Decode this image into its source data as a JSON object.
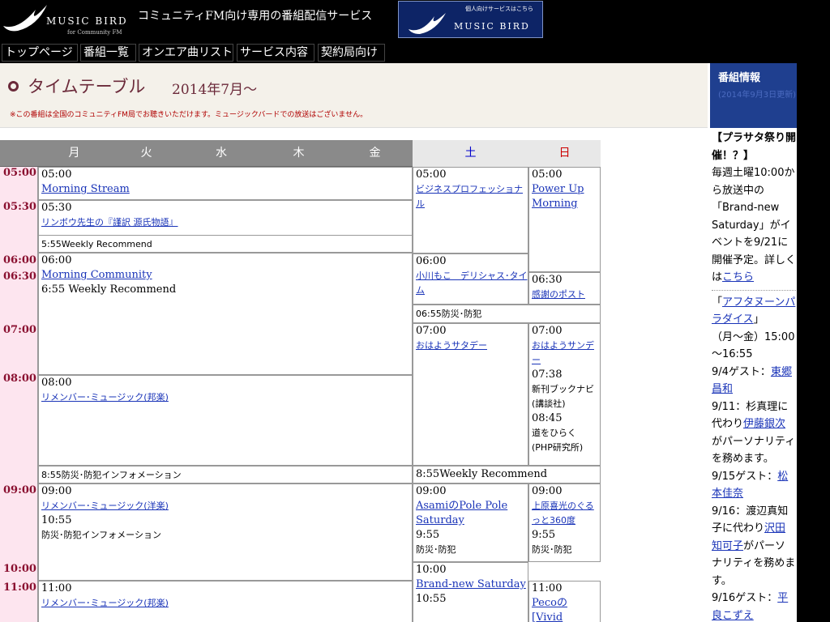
{
  "header": {
    "logo_text": "MUSIC BIRD",
    "logo_sub": "for Community FM",
    "tagline": "コミュニティFM向け専用の番組配信サービス",
    "personal_btn_small": "個人向けサービスはこちら",
    "personal_btn_big": "MUSIC BIRD"
  },
  "nav": [
    "トップページ",
    "番組一覧",
    "オンエア曲リスト",
    "サービス内容",
    "契約局向け"
  ],
  "title": {
    "text": "タイムテーブル",
    "month": "2014年7月～",
    "notice": "※この番組は全国のコミュニティFM局でお聴きいただけます。ミュージックバードでの放送はございません。"
  },
  "days": [
    "月",
    "火",
    "水",
    "木",
    "金",
    "土",
    "日"
  ],
  "times": [
    "05:00",
    "05:30",
    "06:00",
    "06:30",
    "07:00",
    "08:00",
    "09:00",
    "10:00",
    "11:00"
  ],
  "weekday": {
    "b1": [
      "05:00",
      "Morning Stream"
    ],
    "b2": [
      "05:30",
      "リンボウ先生の『謹訳 源氏物語』"
    ],
    "b2b": "5:55Weekly Recommend",
    "b3": [
      "06:00",
      "Morning Community",
      "6:55 Weekly Recommend"
    ],
    "b4": [
      "08:00",
      "リメンバー･ミュージック(邦楽)"
    ],
    "b4b": "8:55防災･防犯インフォメーション",
    "b5": [
      "09:00",
      "リメンバー･ミュージック(洋楽)",
      "10:55",
      "防災･防犯インフォメーション"
    ],
    "b6": [
      "11:00",
      "リメンバー･ミュージック(邦楽)"
    ]
  },
  "sat": {
    "s1": [
      "05:00",
      "ビジネスプロフェッショナル"
    ],
    "s2": [
      "06:00",
      "小川もこ　デリシャス･タイム"
    ],
    "s3": "06:55防災･防犯",
    "s4": [
      "07:00",
      "おはようサタデー"
    ],
    "s5": "8:55Weekly Recommend",
    "s6": [
      "09:00",
      "AsamiのPole Pole Saturday",
      "9:55",
      "防災･防犯"
    ],
    "s7": [
      "10:00",
      "Brand-new Saturday",
      "10:55"
    ]
  },
  "sun": {
    "u1": [
      "05:00",
      "Power Up Morning"
    ],
    "u2": [
      "06:30",
      "感謝のポスト"
    ],
    "u3": [
      "07:00",
      "おはようサンデー",
      "07:38",
      "新刊ブックナビ",
      "(講談社)",
      "08:45",
      "道をひらく",
      "(PHP研究所)"
    ],
    "u4": [
      "09:00",
      "上原喜光のぐるっと360度",
      "9:55",
      "防災･防犯"
    ],
    "u5": [
      "11:00",
      "Pecoの",
      "[Vivid"
    ]
  },
  "side": {
    "title": "番組情報",
    "date": "(2014年9月3日更新)",
    "p1": "【プラサタ祭り開催！？】",
    "p2": "毎週土曜10:00から放送中の「Brand-new Saturday」がイベントを9/21に開催予定。詳しくは",
    "p2_link": "こちら",
    "p3_link": "アフタヌーンパラダイス",
    "p3": "（月～金）15:00～16:55",
    "g1": "9/4ゲスト：",
    "g1_link": "東郷昌和",
    "g2": "9/11：杉真理に代わり",
    "g2_link": "伊藤銀次",
    "g2b": "がパーソナリティを務めます。",
    "g3": "9/15ゲスト：",
    "g3_link": "松本佳奈",
    "g4": "9/16：渡辺真知子に代わり",
    "g4_link": "沢田知可子",
    "g4b": "がパーソナリティを務めます。",
    "g5": "9/16ゲスト：",
    "g5_link": "平良こずえ"
  }
}
